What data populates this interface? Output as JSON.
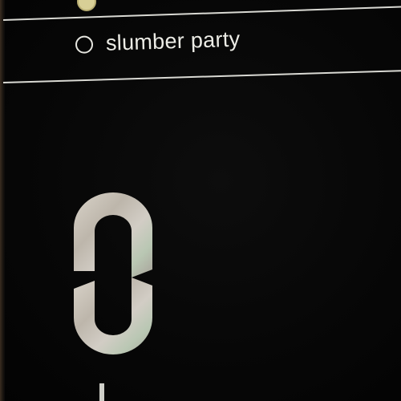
{
  "form": {
    "options": [
      {
        "label": "slumber party",
        "selected": false
      }
    ]
  },
  "colors": {
    "background": "#060606",
    "rule": "#d9d9d3",
    "text": "#ecece6",
    "selected_option": "#d8cf96",
    "logo_metal": "#c9c4bc"
  },
  "logo": {
    "icon": "chain-link-logo-icon"
  }
}
